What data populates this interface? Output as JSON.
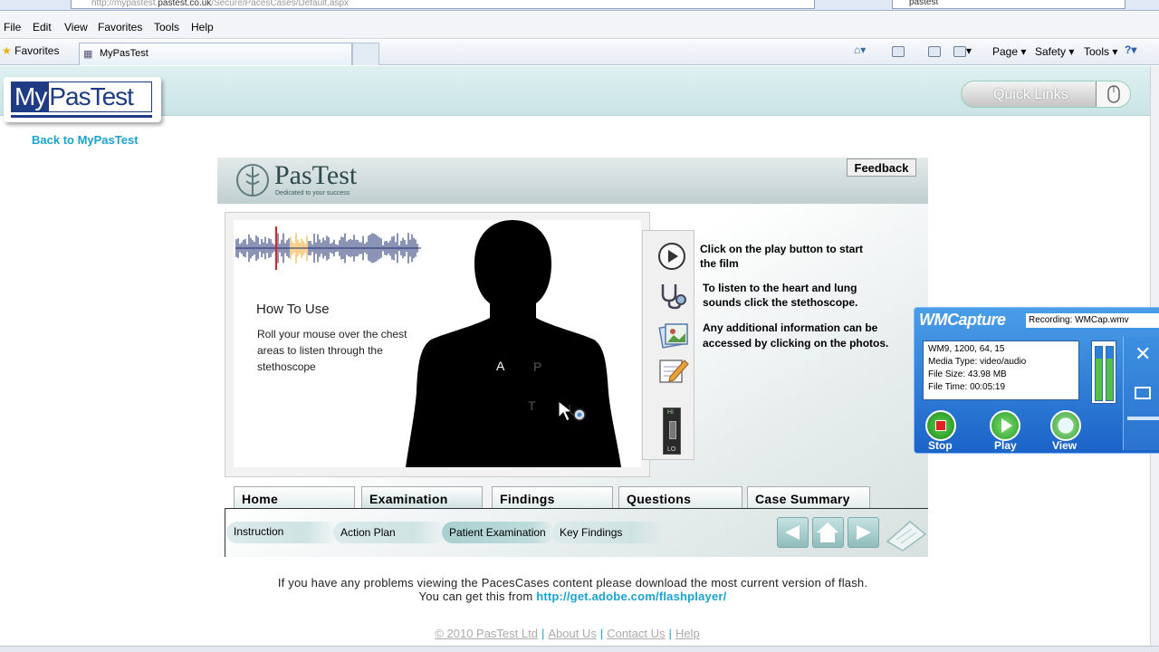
{
  "browser": {
    "address_prefix": "http://mypastest.",
    "address_domain": "pastest.co.uk",
    "address_path": "/Secure/PacesCases/Default.aspx",
    "search_text": "pastest",
    "menu": [
      "File",
      "Edit",
      "View",
      "Favorites",
      "Tools",
      "Help"
    ],
    "favorites_label": "Favorites",
    "tab_title": "MyPasTest",
    "commands": {
      "page": "Page ▾",
      "safety": "Safety ▾",
      "tools": "Tools ▾"
    }
  },
  "site": {
    "logo_my": "My",
    "logo_rest": "PasTest",
    "back_link": "Back to MyPasTest",
    "quick_links": "Quick Links"
  },
  "app": {
    "brand": "PasTest",
    "tagline": "Dedicated to your success",
    "feedback": "Feedback",
    "how_to_use_title": "How To Use",
    "how_to_use_text": "Roll your mouse over the chest areas to listen through the stethoscope",
    "areas": {
      "a": "A",
      "p": "P",
      "t": "T"
    },
    "instructions": [
      "Click on the play button to start the film",
      "To listen to the heart and lung sounds click the stethoscope.",
      "Any additional information can be accessed by clicking on the photos."
    ],
    "volume_hi": "HI",
    "volume_lo": "LO",
    "tabs": [
      "Home",
      "Examination",
      "Findings",
      "Questions",
      "Case Summary"
    ],
    "active_tab": "Examination",
    "subtabs": [
      "Instruction",
      "Action Plan",
      "Patient Examination",
      "Key Findings"
    ],
    "active_subtab": "Patient Examination"
  },
  "footer": {
    "flash_line1": "If you have any problems viewing the PacesCases content please download the most current version of flash.",
    "flash_line2_prefix": "You can get this from",
    "flash_link": "http://get.adobe.com/flashplayer/",
    "copyright": "© 2010 PasTest Ltd",
    "about": "About Us",
    "contact": "Contact Us",
    "help": "Help",
    "separator": "|"
  },
  "wmcapture": {
    "title": "WMCapture",
    "recording": "Recording: WMCap.wmv",
    "info": [
      "WM9, 1200, 64, 15",
      "Media Type: video/audio",
      "File Size: 43.98 MB",
      "File Time: 00:05:19"
    ],
    "buttons": {
      "stop": "Stop",
      "play": "Play",
      "view": "View"
    },
    "meter_levels": [
      0.95,
      0.95
    ]
  },
  "colors": {
    "accent_link": "#1aa3cf",
    "brand_navy": "#1f3b83",
    "header_teal": "#c9e4e6",
    "wm_blue": "#1b63c8"
  }
}
